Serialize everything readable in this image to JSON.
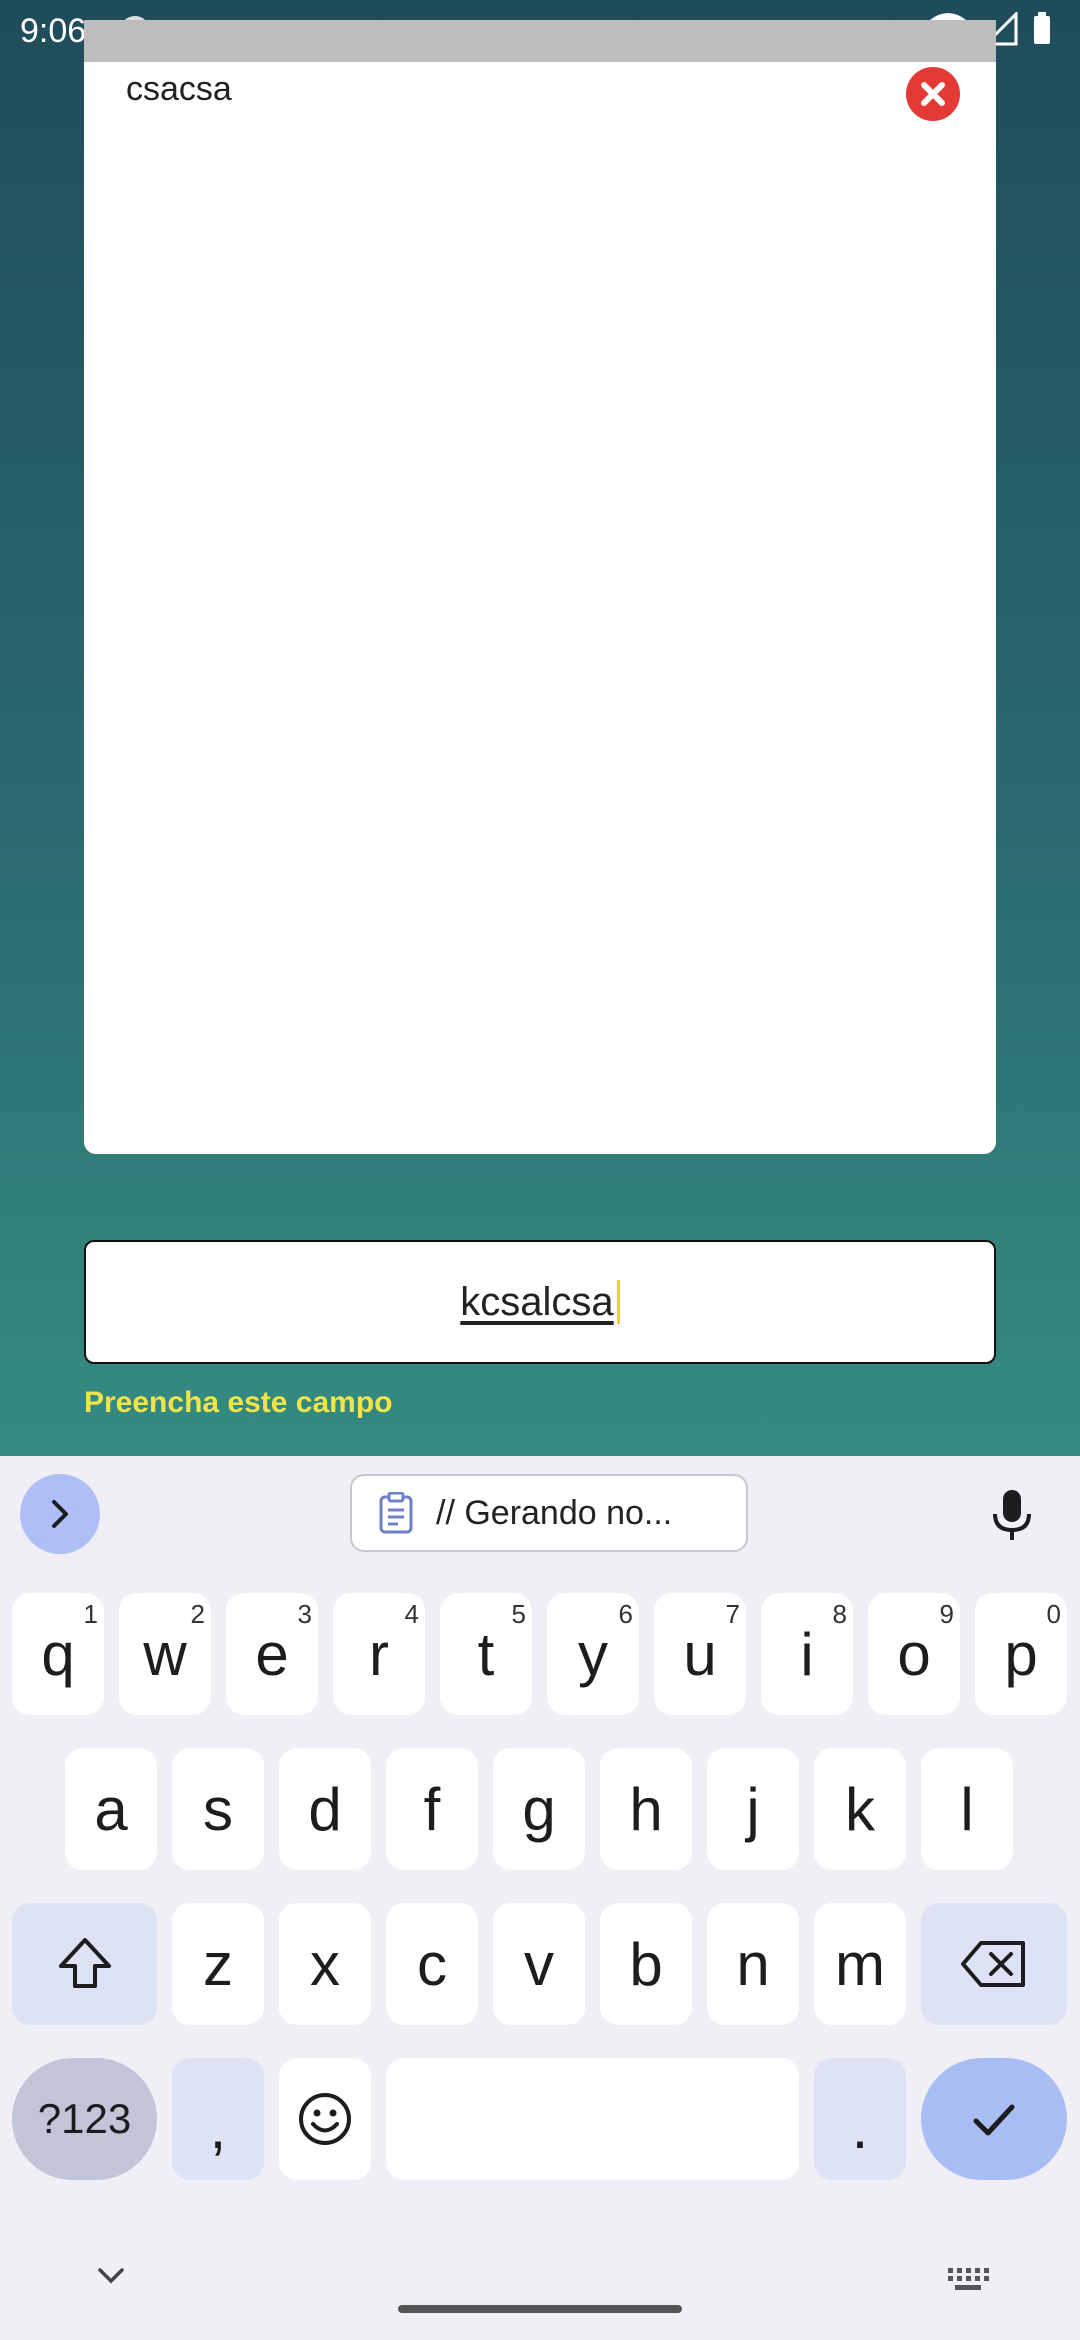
{
  "status": {
    "time": "9:06"
  },
  "card": {
    "text": "csacsa"
  },
  "input": {
    "value": "kcsalcsa",
    "hint": "Preencha este campo"
  },
  "keyboard": {
    "clipboard_chip": "// Gerando no...",
    "row1": [
      {
        "label": "q",
        "hint": "1"
      },
      {
        "label": "w",
        "hint": "2"
      },
      {
        "label": "e",
        "hint": "3"
      },
      {
        "label": "r",
        "hint": "4"
      },
      {
        "label": "t",
        "hint": "5"
      },
      {
        "label": "y",
        "hint": "6"
      },
      {
        "label": "u",
        "hint": "7"
      },
      {
        "label": "i",
        "hint": "8"
      },
      {
        "label": "o",
        "hint": "9"
      },
      {
        "label": "p",
        "hint": "0"
      }
    ],
    "row2": [
      "a",
      "s",
      "d",
      "f",
      "g",
      "h",
      "j",
      "k",
      "l"
    ],
    "row3": [
      "z",
      "x",
      "c",
      "v",
      "b",
      "n",
      "m"
    ],
    "symbols_label": "?123",
    "comma_label": ",",
    "period_label": "."
  }
}
